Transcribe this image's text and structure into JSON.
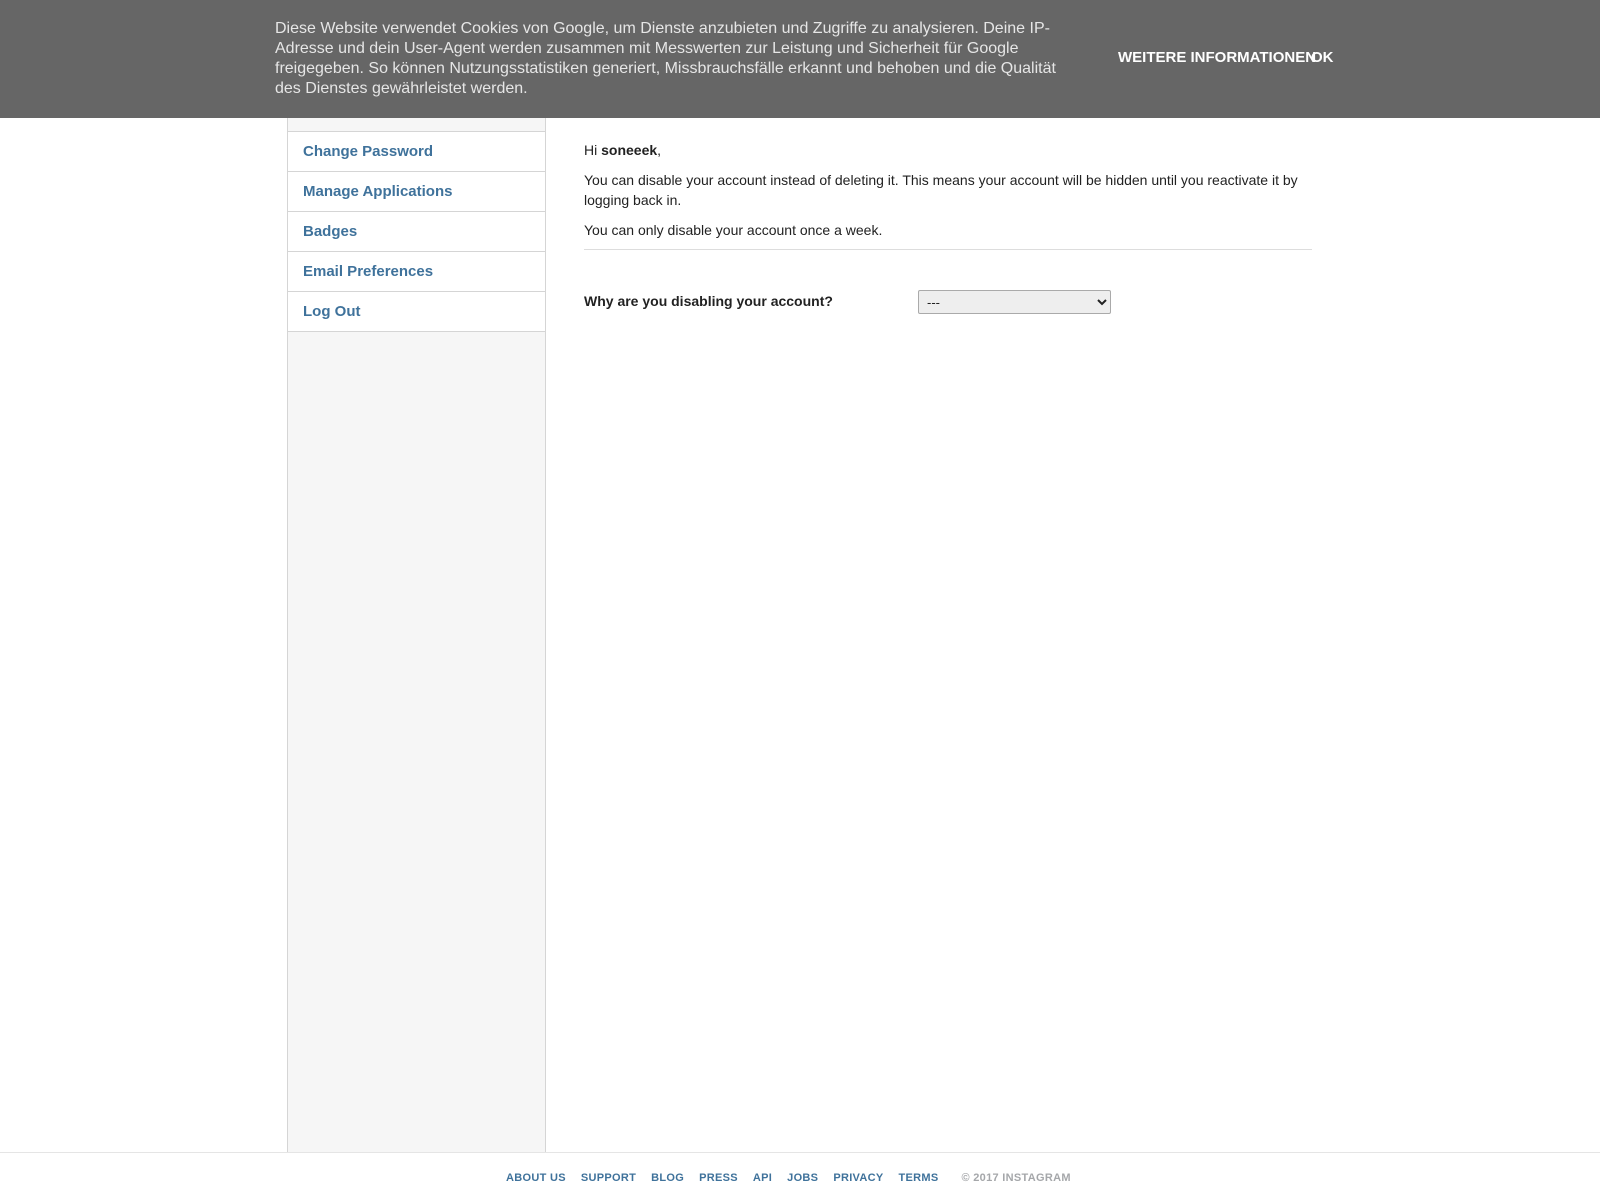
{
  "cookie_banner": {
    "text": "Diese Website verwendet Cookies von Google, um Dienste anzubieten und Zugriffe zu analysieren. Deine IP-Adresse und dein User-Agent werden zusammen mit Messwerten zur Leistung und Sicherheit für Google freigegeben. So können Nutzungsstatistiken generiert, Missbrauchsfälle erkannt und behoben und die Qualität des Dienstes gewährleistet werden.",
    "more_info_label": "WEITERE INFORMATIONEN",
    "ok_label": "OK"
  },
  "sidebar": {
    "items": [
      {
        "label": "Change Password"
      },
      {
        "label": "Manage Applications"
      },
      {
        "label": "Badges"
      },
      {
        "label": "Email Preferences"
      },
      {
        "label": "Log Out"
      }
    ]
  },
  "main": {
    "greeting_prefix": "Hi ",
    "username": "soneeek",
    "greeting_suffix": ",",
    "paragraph1": "You can disable your account instead of deleting it. This means your account will be hidden until you reactivate it by logging back in.",
    "paragraph2": "You can only disable your account once a week.",
    "question": "Why are you disabling your account?",
    "reason_select_value": "---"
  },
  "footer": {
    "links": [
      {
        "label": "ABOUT US"
      },
      {
        "label": "SUPPORT"
      },
      {
        "label": "BLOG"
      },
      {
        "label": "PRESS"
      },
      {
        "label": "API"
      },
      {
        "label": "JOBS"
      },
      {
        "label": "PRIVACY"
      },
      {
        "label": "TERMS"
      }
    ],
    "copyright": "© 2017 INSTAGRAM"
  },
  "colors": {
    "banner_bg": "#666666",
    "link_blue": "#3f729b",
    "sidebar_bg": "#f6f6f6"
  }
}
